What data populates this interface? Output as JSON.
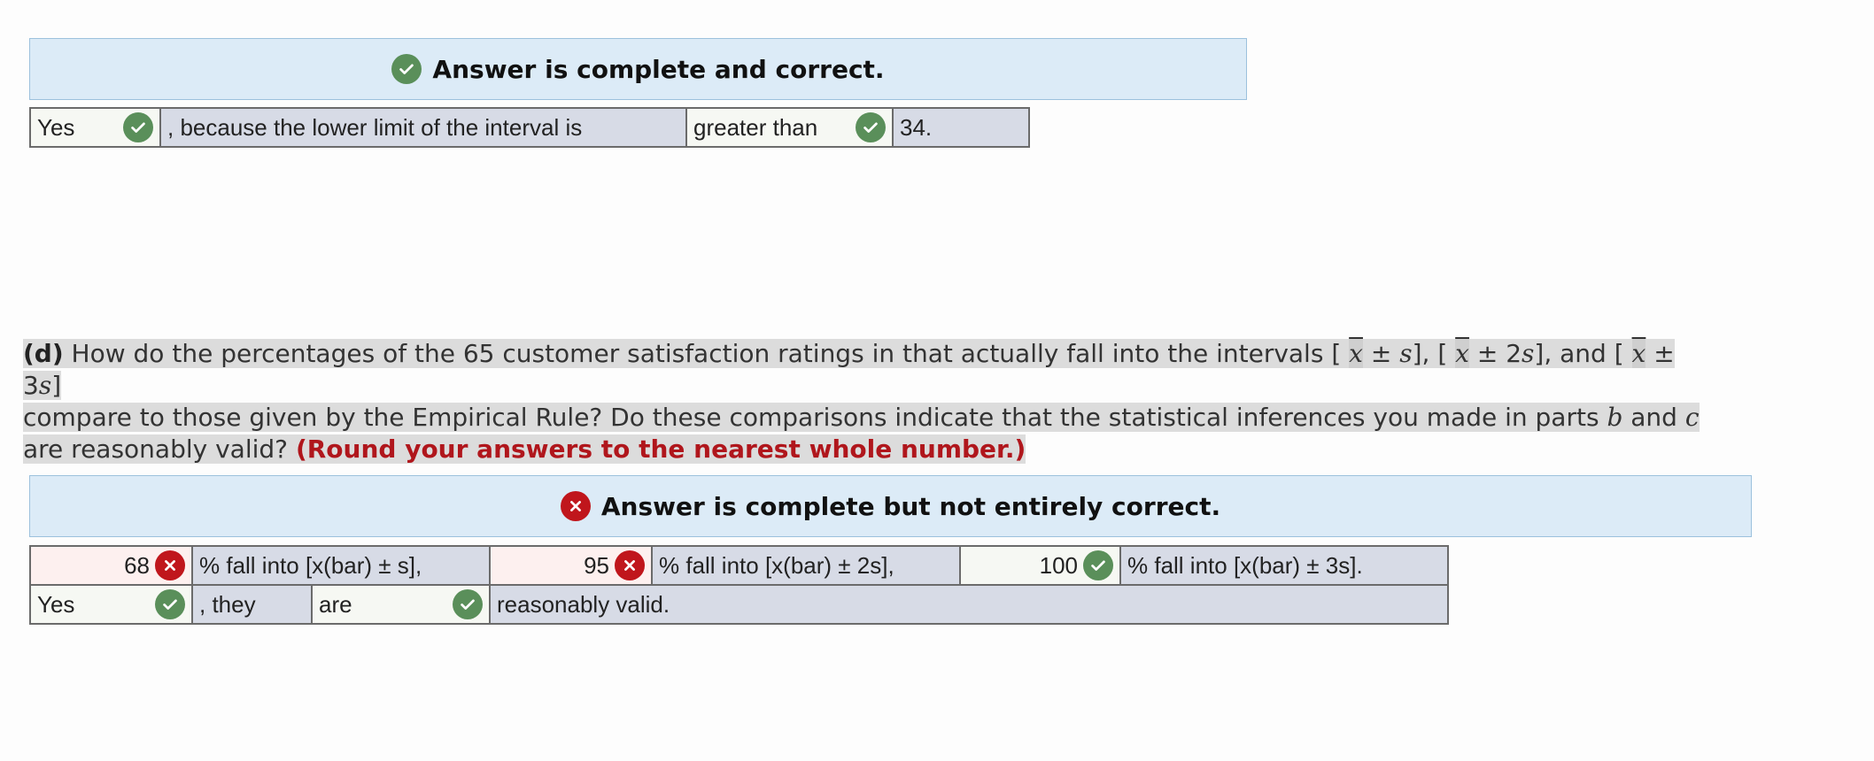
{
  "panel1": {
    "banner_text": "Answer is complete and correct.",
    "row": {
      "answer1": "Yes",
      "text1": ", because the lower limit of the interval is",
      "answer2": "greater than",
      "text2": "34."
    }
  },
  "question": {
    "label": "(d)",
    "line1_a": "How do the percentages of the 65 customer satisfaction ratings in that actually fall into the intervals [",
    "xbar": "x",
    "int1_suffix": " ± ",
    "s1": "s",
    "sep1": "], [",
    "int2_suffix": " ± 2",
    "s2": "s",
    "sep2": "], and [",
    "int3_suffix": " ± 3",
    "s3": "s",
    "close": "]",
    "line2_a": "compare to those given by the Empirical Rule? Do these comparisons indicate that the statistical inferences you made in parts ",
    "part_b": "b",
    "and": " and ",
    "part_c": "c",
    "line3_a": "are reasonably valid? ",
    "instruction": "(Round your answers to the nearest whole number.)"
  },
  "panel2": {
    "banner_text": "Answer is complete but not entirely correct.",
    "row1": {
      "val1": "68",
      "text1": "% fall into [x(bar) ± s],",
      "val2": "95",
      "text2": "% fall into [x(bar) ± 2s],",
      "val3": "100",
      "text3": "% fall into [x(bar) ± 3s]."
    },
    "row2": {
      "answer1": "Yes",
      "text1": ", they",
      "answer2": "are",
      "text2": "reasonably valid."
    }
  },
  "colors": {
    "correct": "#5a8f5a",
    "incorrect": "#c0161c",
    "banner_bg": "#dcebf7",
    "static_cell": "#d7dbe6"
  },
  "icons": [
    "check-circle-icon",
    "x-circle-icon"
  ]
}
